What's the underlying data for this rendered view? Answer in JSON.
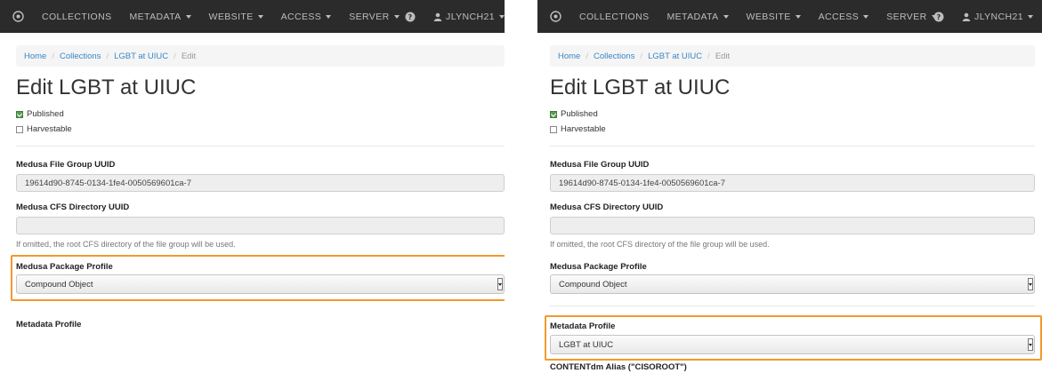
{
  "nav": {
    "items": [
      "COLLECTIONS",
      "METADATA",
      "WEBSITE",
      "ACCESS",
      "SERVER"
    ],
    "dropdown_flags": [
      false,
      true,
      true,
      true,
      true
    ],
    "user": "JLYNCH21"
  },
  "breadcrumb": {
    "home": "Home",
    "collections": "Collections",
    "collection": "LGBT at UIUC",
    "current": "Edit"
  },
  "page": {
    "title": "Edit LGBT at UIUC",
    "published_label": "Published",
    "published_checked": true,
    "harvestable_label": "Harvestable",
    "harvestable_checked": false
  },
  "fields": {
    "file_group_label": "Medusa File Group UUID",
    "file_group_value": "19614d90-8745-0134-1fe4-0050569601ca-7",
    "cfs_label": "Medusa CFS Directory UUID",
    "cfs_value": "",
    "cfs_help": "If omitted, the root CFS directory of the file group will be used.",
    "package_label": "Medusa Package Profile",
    "package_value": "Compound Object",
    "metadata_label": "Metadata Profile",
    "metadata_value": "LGBT at UIUC",
    "contentdm_label": "CONTENTdm Alias (\"CISOROOT\")"
  },
  "colors": {
    "navbar": "#2b2b2b",
    "link": "#3a86c8",
    "highlight": "#f39a2c",
    "checked": "#5a9e55"
  }
}
